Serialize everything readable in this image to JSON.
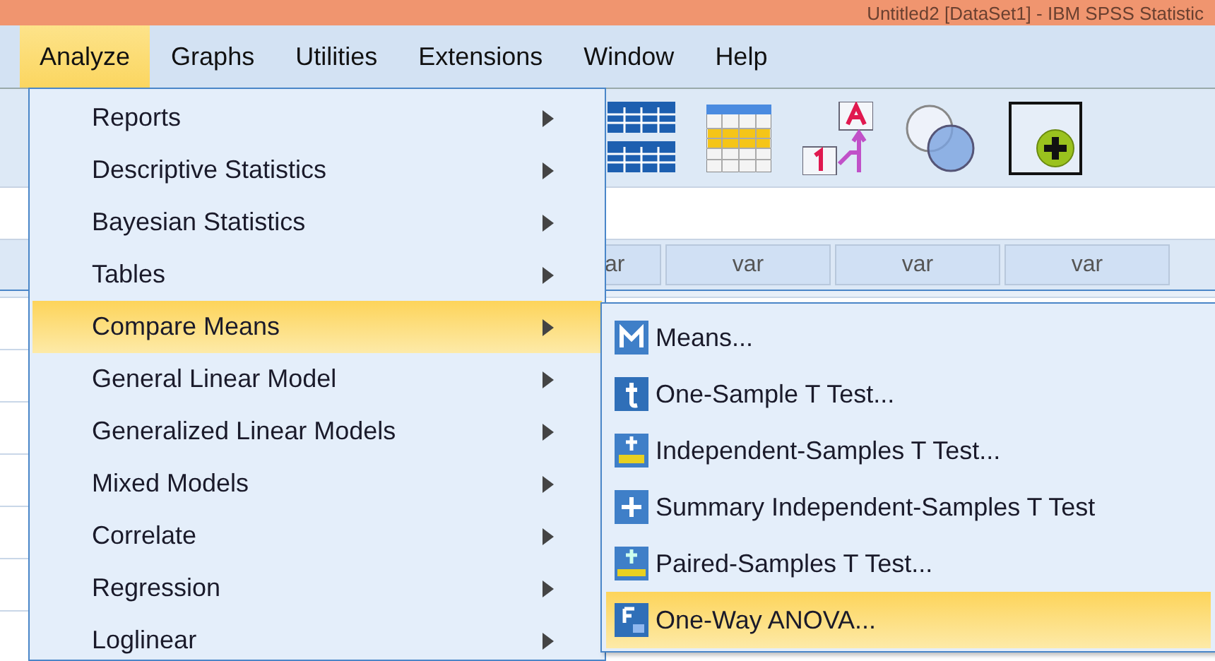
{
  "window": {
    "title": "Untitled2 [DataSet1] - IBM SPSS Statistic"
  },
  "menu_bar": [
    {
      "label": "Analyze",
      "selected": true
    },
    {
      "label": "Graphs",
      "selected": false
    },
    {
      "label": "Utilities",
      "selected": false
    },
    {
      "label": "Extensions",
      "selected": false
    },
    {
      "label": "Window",
      "selected": false
    },
    {
      "label": "Help",
      "selected": false
    }
  ],
  "grid": {
    "columns": [
      "ar",
      "var",
      "var",
      "var"
    ]
  },
  "analyze_menu": [
    {
      "label": "Reports",
      "selected": false
    },
    {
      "label": "Descriptive Statistics",
      "selected": false
    },
    {
      "label": "Bayesian Statistics",
      "selected": false
    },
    {
      "label": "Tables",
      "selected": false
    },
    {
      "label": "Compare Means",
      "selected": true
    },
    {
      "label": "General Linear Model",
      "selected": false
    },
    {
      "label": "Generalized Linear Models",
      "selected": false
    },
    {
      "label": "Mixed Models",
      "selected": false
    },
    {
      "label": "Correlate",
      "selected": false
    },
    {
      "label": "Regression",
      "selected": false
    },
    {
      "label": "Loglinear",
      "selected": false
    }
  ],
  "compare_means_menu": [
    {
      "label": "Means...",
      "kind": "m",
      "selected": false
    },
    {
      "label": "One-Sample T Test...",
      "kind": "t",
      "selected": false
    },
    {
      "label": "Independent-Samples T Test...",
      "kind": "tab",
      "selected": false
    },
    {
      "label": "Summary Independent-Samples T Test",
      "kind": "plus",
      "selected": false
    },
    {
      "label": "Paired-Samples T Test...",
      "kind": "paired",
      "selected": false
    },
    {
      "label": "One-Way ANOVA...",
      "kind": "f",
      "selected": true
    }
  ]
}
